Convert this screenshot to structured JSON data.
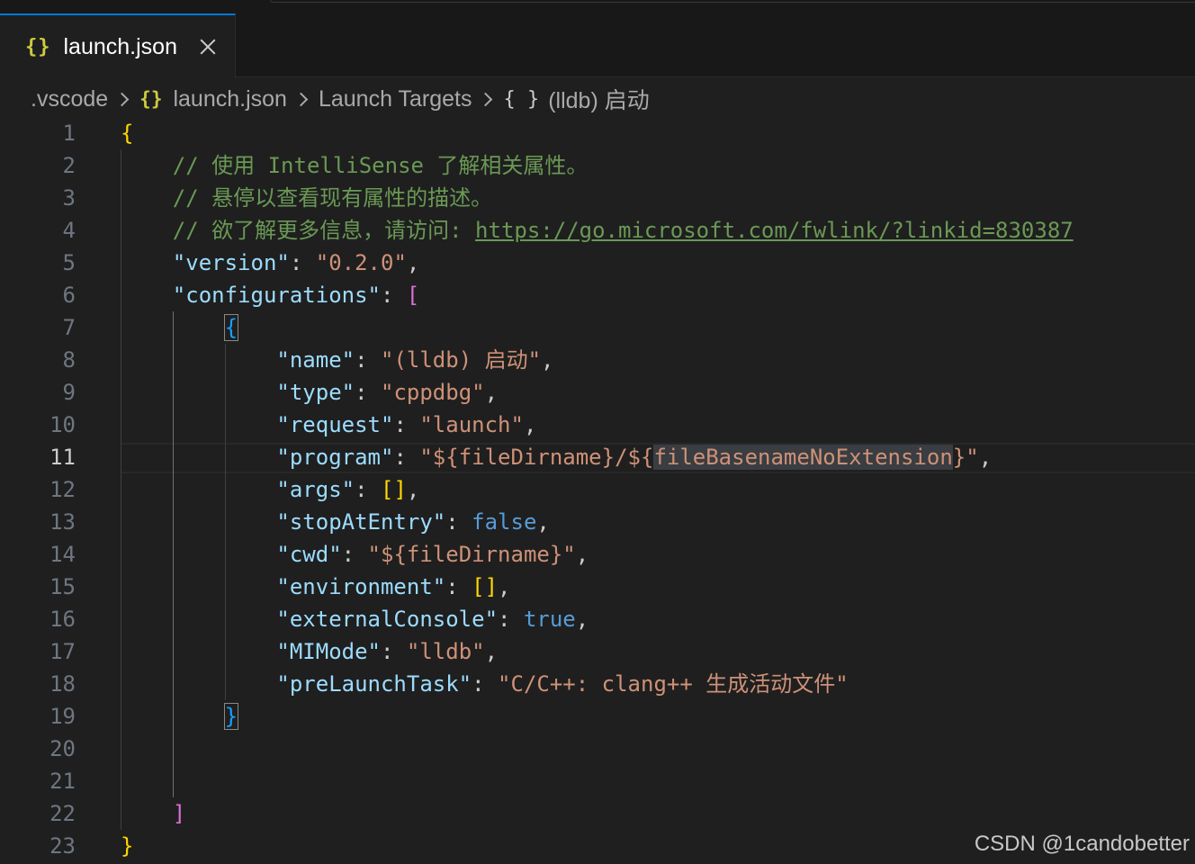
{
  "tab": {
    "icon": "json-braces-icon",
    "title": "launch.json",
    "close_icon": "close-icon"
  },
  "breadcrumb": {
    "items": [
      ".vscode",
      "launch.json",
      "Launch Targets",
      "(lldb) 启动"
    ],
    "json_icon": "{}",
    "object_icon": "{ }"
  },
  "editor": {
    "current_line": 11,
    "lines": [
      {
        "n": "1",
        "t": [
          [
            "{",
            "b1"
          ]
        ]
      },
      {
        "n": "2",
        "t": [
          [
            "    // 使用 IntelliSense 了解相关属性。",
            "c"
          ]
        ]
      },
      {
        "n": "3",
        "t": [
          [
            "    // 悬停以查看现有属性的描述。",
            "c"
          ]
        ]
      },
      {
        "n": "4",
        "t": [
          [
            "    // 欲了解更多信息，请访问: ",
            "c"
          ],
          [
            "https://go.microsoft.com/fwlink/?linkid=830387",
            "lnk"
          ]
        ]
      },
      {
        "n": "5",
        "t": [
          [
            "    \"version\"",
            "k"
          ],
          [
            ": ",
            "p"
          ],
          [
            "\"0.2.0\"",
            "s"
          ],
          [
            ",",
            "p"
          ]
        ]
      },
      {
        "n": "6",
        "t": [
          [
            "    \"configurations\"",
            "k"
          ],
          [
            ": ",
            "p"
          ],
          [
            "[",
            "b2"
          ]
        ]
      },
      {
        "n": "7",
        "t": [
          [
            "        ",
            "p"
          ],
          [
            "{",
            "b3 bm"
          ]
        ]
      },
      {
        "n": "8",
        "t": [
          [
            "            \"name\"",
            "k"
          ],
          [
            ": ",
            "p"
          ],
          [
            "\"(lldb) 启动\"",
            "s"
          ],
          [
            ",",
            "p"
          ]
        ]
      },
      {
        "n": "9",
        "t": [
          [
            "            \"type\"",
            "k"
          ],
          [
            ": ",
            "p"
          ],
          [
            "\"cppdbg\"",
            "s"
          ],
          [
            ",",
            "p"
          ]
        ]
      },
      {
        "n": "10",
        "t": [
          [
            "            \"request\"",
            "k"
          ],
          [
            ": ",
            "p"
          ],
          [
            "\"launch\"",
            "s"
          ],
          [
            ",",
            "p"
          ]
        ]
      },
      {
        "n": "11",
        "t": [
          [
            "            \"program\"",
            "k"
          ],
          [
            ": ",
            "p"
          ],
          [
            "\"${fileDirname}/${",
            "s"
          ],
          [
            "fileBasenameNoExtension",
            "s hl"
          ],
          [
            "}\"",
            "s"
          ],
          [
            ",",
            "p"
          ]
        ]
      },
      {
        "n": "12",
        "t": [
          [
            "            \"args\"",
            "k"
          ],
          [
            ": ",
            "p"
          ],
          [
            "[]",
            "b1"
          ],
          [
            ",",
            "p"
          ]
        ]
      },
      {
        "n": "13",
        "t": [
          [
            "            \"stopAtEntry\"",
            "k"
          ],
          [
            ": ",
            "p"
          ],
          [
            "false",
            "kw"
          ],
          [
            ",",
            "p"
          ]
        ]
      },
      {
        "n": "14",
        "t": [
          [
            "            \"cwd\"",
            "k"
          ],
          [
            ": ",
            "p"
          ],
          [
            "\"${fileDirname}\"",
            "s"
          ],
          [
            ",",
            "p"
          ]
        ]
      },
      {
        "n": "15",
        "t": [
          [
            "            \"environment\"",
            "k"
          ],
          [
            ": ",
            "p"
          ],
          [
            "[]",
            "b1"
          ],
          [
            ",",
            "p"
          ]
        ]
      },
      {
        "n": "16",
        "t": [
          [
            "            \"externalConsole\"",
            "k"
          ],
          [
            ": ",
            "p"
          ],
          [
            "true",
            "kw"
          ],
          [
            ",",
            "p"
          ]
        ]
      },
      {
        "n": "17",
        "t": [
          [
            "            \"MIMode\"",
            "k"
          ],
          [
            ": ",
            "p"
          ],
          [
            "\"lldb\"",
            "s"
          ],
          [
            ",",
            "p"
          ]
        ]
      },
      {
        "n": "18",
        "t": [
          [
            "            \"preLaunchTask\"",
            "k"
          ],
          [
            ": ",
            "p"
          ],
          [
            "\"C/C++: clang++ 生成活动文件\"",
            "s"
          ]
        ]
      },
      {
        "n": "19",
        "t": [
          [
            "        ",
            "p"
          ],
          [
            "}",
            "b3 bm"
          ]
        ]
      },
      {
        "n": "20",
        "t": []
      },
      {
        "n": "21",
        "t": []
      },
      {
        "n": "22",
        "t": [
          [
            "    ",
            "p"
          ],
          [
            "]",
            "b2"
          ]
        ]
      },
      {
        "n": "23",
        "t": [
          [
            "}",
            "b1"
          ]
        ]
      }
    ]
  },
  "watermark": "CSDN @1candobetter"
}
